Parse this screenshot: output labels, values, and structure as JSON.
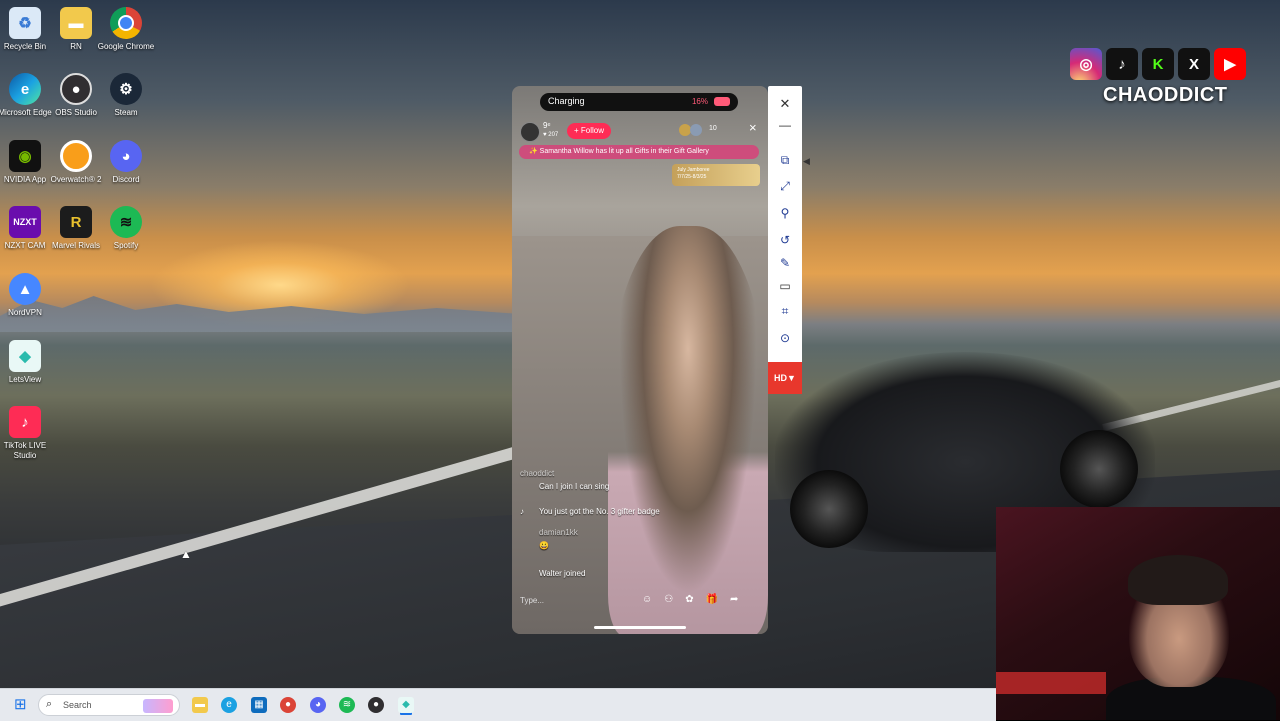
{
  "desktop_icons": [
    {
      "label": "Recycle Bin",
      "icon": "recycle-bin-icon",
      "color": "#dbe9f7"
    },
    {
      "label": "RN",
      "icon": "folder-icon",
      "color": "#f2c94c"
    },
    {
      "label": "Google Chrome",
      "icon": "chrome-icon",
      "color": "#db4437"
    },
    {
      "label": "Microsoft Edge",
      "icon": "edge-icon",
      "color": "#1ba1e2"
    },
    {
      "label": "OBS Studio",
      "icon": "obs-icon",
      "color": "#302e31"
    },
    {
      "label": "Steam",
      "icon": "steam-icon",
      "color": "#1b2838"
    },
    {
      "label": "NVIDIA App",
      "icon": "nvidia-icon",
      "color": "#76b900"
    },
    {
      "label": "Overwatch® 2",
      "icon": "overwatch-icon",
      "color": "#f99e1a"
    },
    {
      "label": "Discord",
      "icon": "discord-icon",
      "color": "#5865f2"
    },
    {
      "label": "NZXT CAM",
      "icon": "nzxt-icon",
      "color": "#6a0dad"
    },
    {
      "label": "Marvel Rivals",
      "icon": "marvel-rivals-icon",
      "color": "#e8c02e"
    },
    {
      "label": "Spotify",
      "icon": "spotify-icon",
      "color": "#1db954"
    },
    {
      "label": "NordVPN",
      "icon": "nordvpn-icon",
      "color": "#4687ff"
    },
    {
      "label": "LetsView",
      "icon": "letsview-icon",
      "color": "#2bbbad"
    },
    {
      "label": "TikTok LIVE Studio",
      "icon": "tiktok-live-icon",
      "color": "#fe2c55"
    }
  ],
  "phone": {
    "status": {
      "charging": "Charging",
      "battery": "16%"
    },
    "host": {
      "name": "9ᵉ",
      "likes": "♥ 207"
    },
    "follow": "+ Follow",
    "viewers": "10",
    "banner": "✨ Samantha Willow has lit up all Gifts in their Gift Gallery",
    "event": {
      "title": "July Jamboree",
      "dates": "7/7/25-8/3/25"
    },
    "comments": [
      {
        "user": "chaoddict",
        "text": "Can I join I can sing"
      },
      {
        "user": "",
        "text": "You just got the No. 3 gifter badge"
      },
      {
        "user": "damian1kk",
        "text": "😀"
      },
      {
        "user": "",
        "text": "Walter joined"
      }
    ],
    "input_placeholder": "Type...",
    "actions": [
      "Guests",
      "Rose",
      "Gift",
      "Share"
    ]
  },
  "toolbar": {
    "buttons": [
      "close-icon",
      "minimize-icon",
      "pip-icon",
      "fullscreen-icon",
      "pin-icon",
      "rotate-icon",
      "pen-icon",
      "whiteboard-icon",
      "crop-icon",
      "record-icon"
    ],
    "hd_label": "HD▼"
  },
  "branding": {
    "name": "CHAODDICT",
    "socials": [
      {
        "name": "instagram-icon",
        "color": "#d62976"
      },
      {
        "name": "tiktok-icon",
        "color": "#111111"
      },
      {
        "name": "kick-icon",
        "color": "#53fc18"
      },
      {
        "name": "x-icon",
        "color": "#111111"
      },
      {
        "name": "youtube-icon",
        "color": "#ff0000"
      }
    ]
  },
  "taskbar": {
    "search_placeholder": "Search",
    "apps": [
      {
        "name": "file-explorer-icon",
        "color": "#f2c94c"
      },
      {
        "name": "edge-icon",
        "color": "#1ba1e2"
      },
      {
        "name": "store-icon",
        "color": "#0f6cbd"
      },
      {
        "name": "chrome-icon",
        "color": "#db4437"
      },
      {
        "name": "discord-icon",
        "color": "#5865f2"
      },
      {
        "name": "spotify-icon",
        "color": "#1db954"
      },
      {
        "name": "obs-icon",
        "color": "#302e31"
      },
      {
        "name": "letsview-icon",
        "color": "#2bbbad"
      }
    ]
  }
}
